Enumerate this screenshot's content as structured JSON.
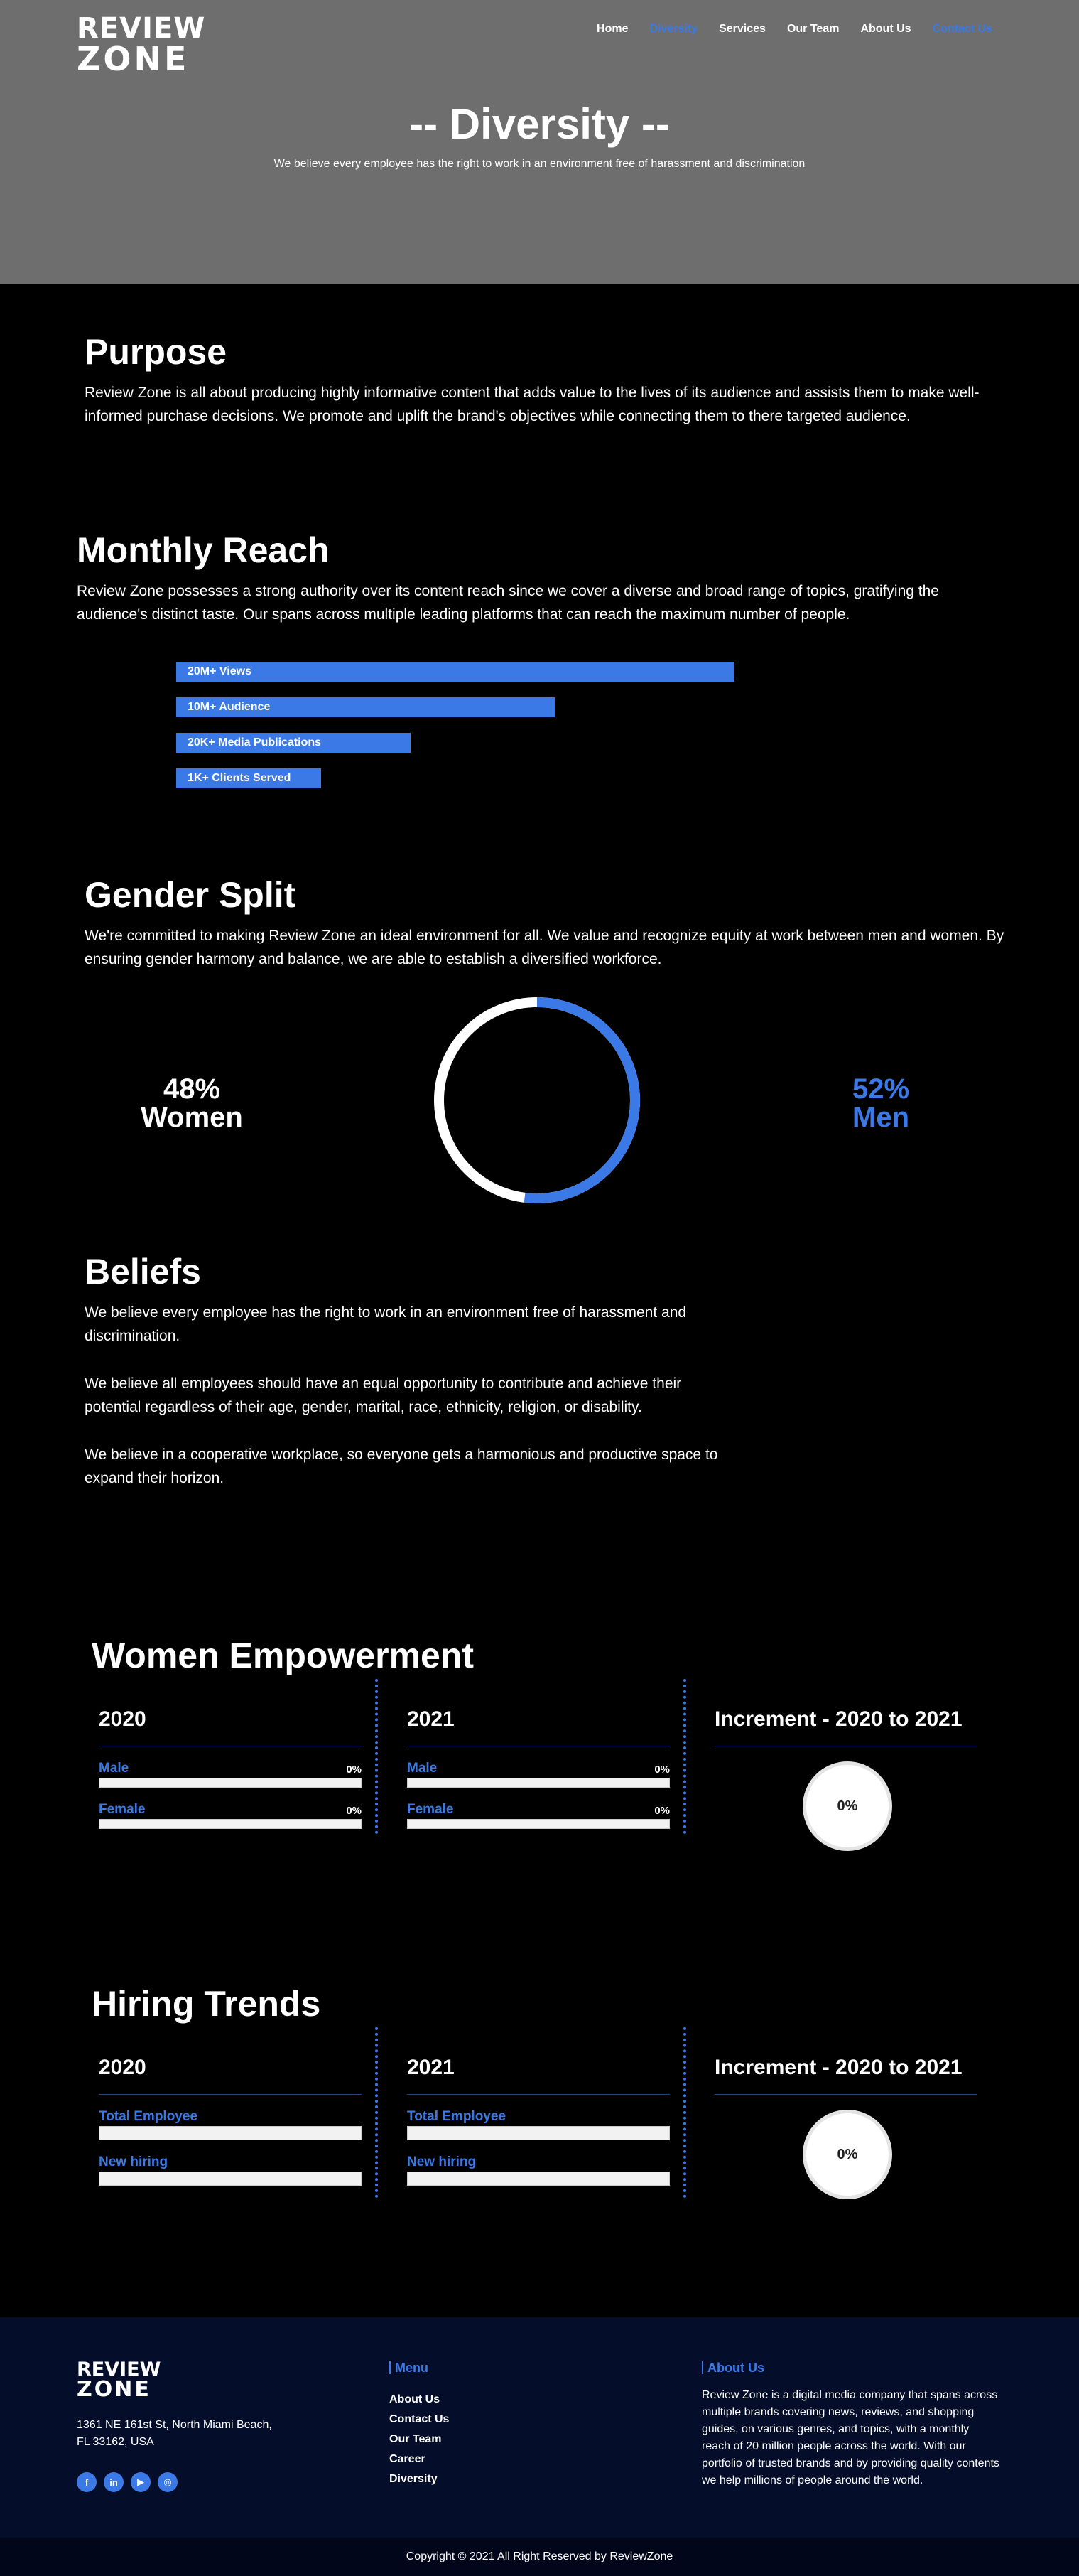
{
  "brand": {
    "line1": "REVIEW",
    "line2": "ZONE"
  },
  "nav": {
    "items": [
      {
        "label": "Home",
        "active": false
      },
      {
        "label": "Diversity",
        "active": true
      },
      {
        "label": "Services",
        "active": false
      },
      {
        "label": "Our Team",
        "active": false
      },
      {
        "label": "About Us",
        "active": false
      },
      {
        "label": "Contact Us",
        "active": true
      }
    ]
  },
  "hero": {
    "title": "-- Diversity --",
    "subtitle": "We believe every employee has the right to work in an environment free of harassment and discrimination"
  },
  "purpose": {
    "title": "Purpose",
    "text": "Review Zone is all about producing highly informative content that adds value to the lives of its audience and assists them to make well-informed purchase decisions. We promote and uplift the brand's objectives while connecting them to there targeted audience."
  },
  "reach": {
    "title": "Monthly Reach",
    "text": "Review Zone possesses a strong authority over its content reach since we cover a diverse and broad range of topics, gratifying the audience's distinct taste. Our spans across multiple leading platforms that can reach the maximum number of people.",
    "bars": [
      {
        "label": "20M+ Views",
        "value": 100
      },
      {
        "label": "10M+ Audience",
        "value": 68
      },
      {
        "label": "20K+ Media Publications",
        "value": 42
      },
      {
        "label": "1K+ Clients Served",
        "value": 26
      }
    ]
  },
  "gender": {
    "title": "Gender Split",
    "text": "We're committed to making Review Zone an ideal environment for all. We value and recognize equity at work between men and women. By ensuring gender harmony and balance, we are able to establish a diversified workforce.",
    "women_pct": "48%",
    "women_label": "Women",
    "men_pct": "52%",
    "men_label": "Men",
    "men_fraction": 0.52,
    "colors": {
      "men": "#3b7ae6",
      "women": "#ffffff"
    }
  },
  "beliefs": {
    "title": "Beliefs",
    "items": [
      "We believe every employee has the right to work in an environment free of harassment and discrimination.",
      "We believe all employees should have an equal opportunity to contribute and achieve their potential regardless of their age, gender, marital, race, ethnicity, religion, or disability.",
      "We believe in a cooperative workplace, so everyone gets a harmonious and productive space to expand their horizon."
    ]
  },
  "empowerment": {
    "title": "Women Empowerment",
    "col2020": {
      "year": "2020",
      "male_label": "Male",
      "male_pct": "0%",
      "female_label": "Female",
      "female_pct": "0%"
    },
    "col2021": {
      "year": "2021",
      "male_label": "Male",
      "male_pct": "0%",
      "female_label": "Female",
      "female_pct": "0%"
    },
    "increment": {
      "title": "Increment - 2020 to 2021",
      "value": "0%"
    }
  },
  "hiring": {
    "title": "Hiring Trends",
    "col2020": {
      "year": "2020",
      "total_label": "Total Employee",
      "new_label": "New hiring"
    },
    "col2021": {
      "year": "2021",
      "total_label": "Total Employee",
      "new_label": "New hiring"
    },
    "increment": {
      "title": "Increment - 2020 to 2021",
      "value": "0%"
    }
  },
  "footer": {
    "address_line1": "1361 NE 161st St, North Miami Beach,",
    "address_line2": "FL 33162, USA",
    "social": [
      "facebook-icon",
      "linkedin-icon",
      "youtube-icon",
      "instagram-icon"
    ],
    "menu_title": "Menu",
    "menu": [
      "About Us",
      "Contact Us",
      "Our Team",
      "Career",
      "Diversity"
    ],
    "about_title": "About Us",
    "about_text": "Review Zone is a digital media company that spans across multiple brands covering news, reviews, and shopping guides, on various genres, and topics, with a monthly reach of 20 million people across the world. With our portfolio of trusted brands and by providing quality contents we help millions of people around the world.",
    "copyright": "Copyright © 2021 All Right Reserved by ReviewZone"
  }
}
